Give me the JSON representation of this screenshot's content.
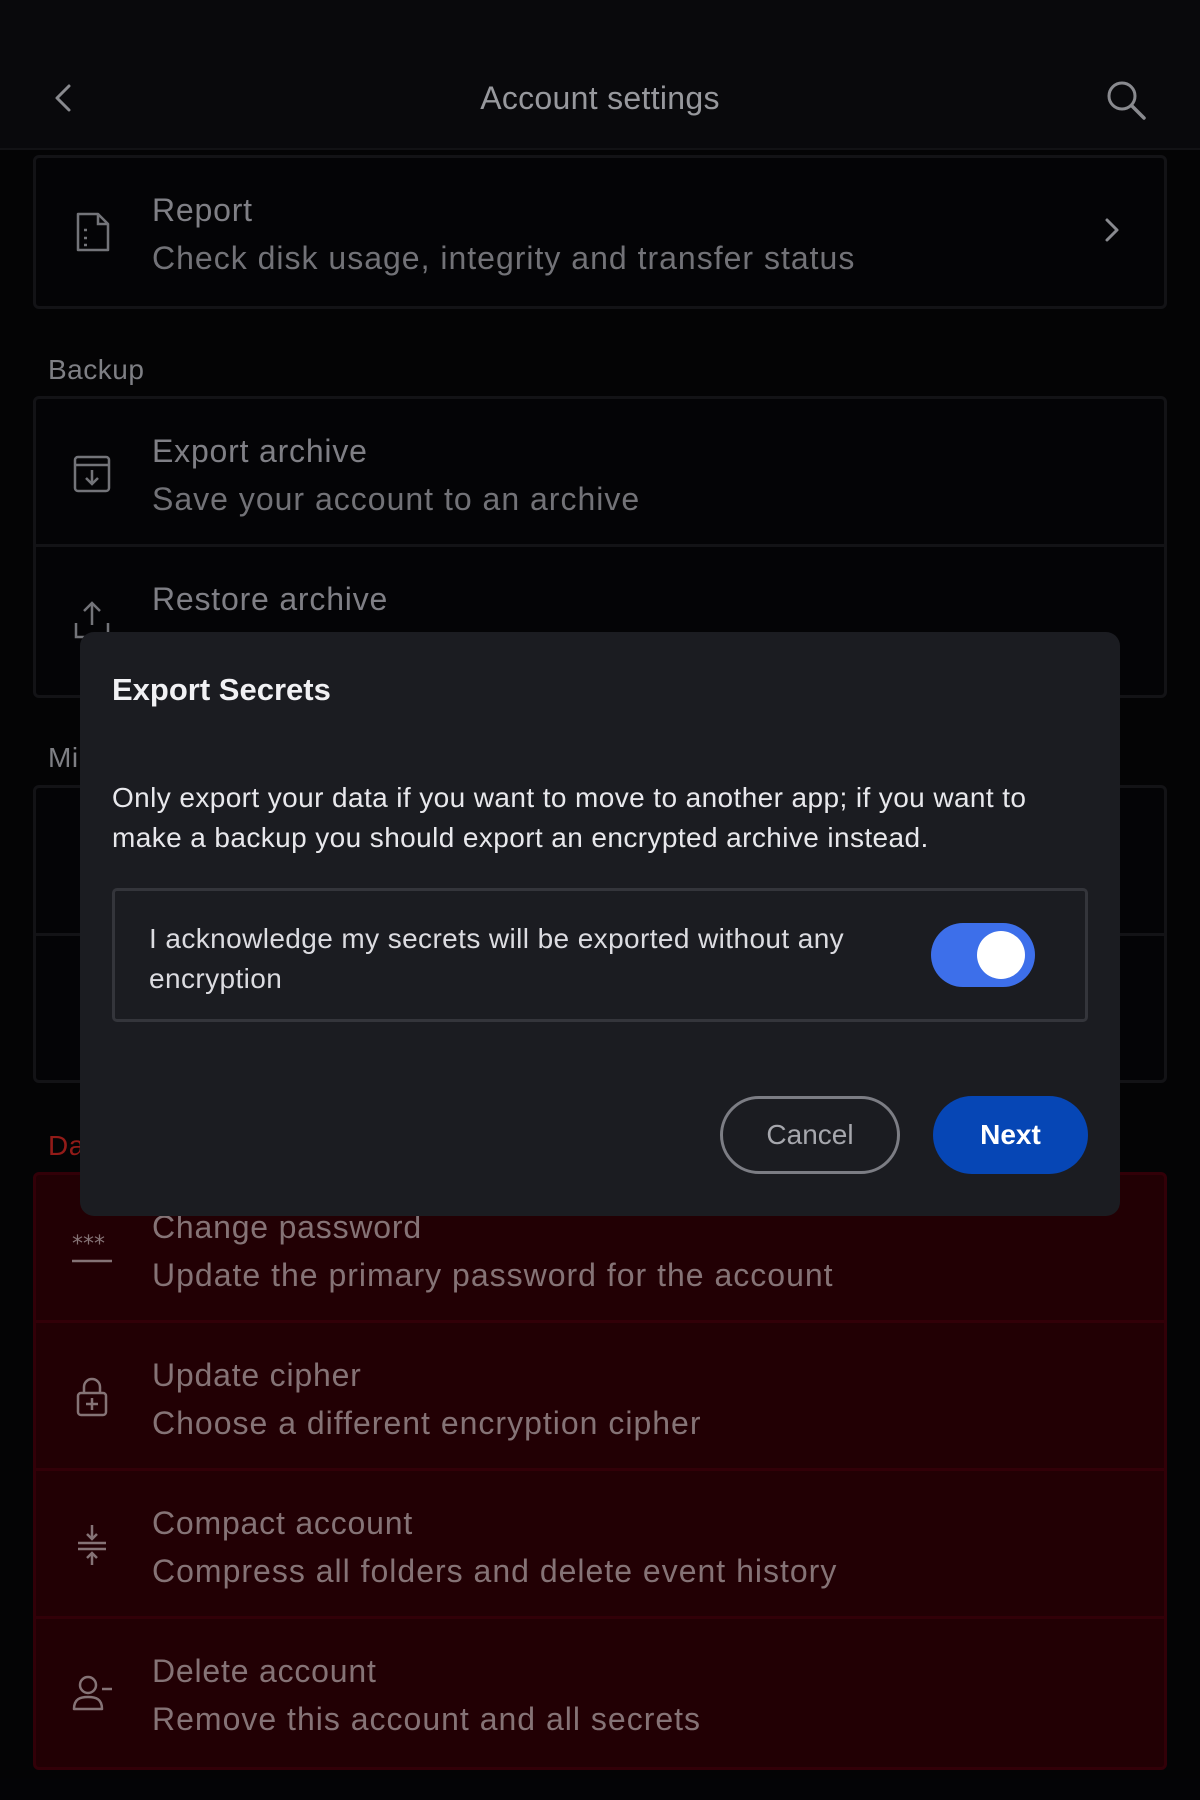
{
  "header": {
    "title": "Account settings",
    "back_icon": "chevron-left-icon",
    "search_icon": "search-icon"
  },
  "report": {
    "title": "Report",
    "subtitle": "Check disk usage, integrity and transfer status",
    "icon": "document-icon"
  },
  "backup": {
    "label": "Backup",
    "items": [
      {
        "title": "Export archive",
        "subtitle": "Save your account to an archive",
        "icon": "archive-download-icon"
      },
      {
        "title": "Restore archive",
        "subtitle": "",
        "icon": "upload-icon"
      }
    ]
  },
  "misc": {
    "label_partial": "Mi"
  },
  "danger": {
    "label_partial": "Da",
    "color": "#b3211e",
    "background": "#2a0005",
    "items": [
      {
        "title": "Change password",
        "subtitle": "Update the primary password for the account",
        "icon": "password-icon"
      },
      {
        "title": "Update cipher",
        "subtitle": "Choose a different encryption cipher",
        "icon": "lock-plus-icon"
      },
      {
        "title": "Compact account",
        "subtitle": "Compress all folders and delete event history",
        "icon": "compress-icon"
      },
      {
        "title": "Delete account",
        "subtitle": "Remove this account and all secrets",
        "icon": "user-minus-icon"
      }
    ]
  },
  "dialog": {
    "title": "Export Secrets",
    "body": "Only export your data if you want to move to another app; if you want to make a backup you should export an encrypted archive instead.",
    "acknowledge": "I acknowledge my secrets will be exported without any encryption",
    "toggle_on": true,
    "toggle_color": "#3d6fea",
    "cancel_label": "Cancel",
    "next_label": "Next",
    "next_color": "#0646b5"
  }
}
